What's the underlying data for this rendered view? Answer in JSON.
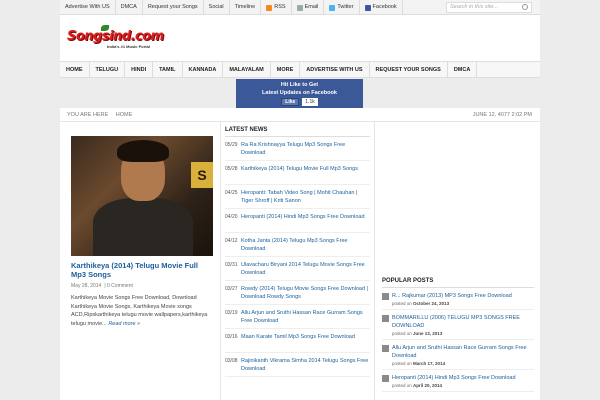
{
  "topbar": {
    "links": [
      "Advertise With US",
      "DMCA",
      "Request your Songs",
      "Social",
      "Timeline"
    ],
    "social": [
      {
        "label": "RSS",
        "icon": "rss-icon"
      },
      {
        "label": "Email",
        "icon": "email-icon"
      },
      {
        "label": "Twitter",
        "icon": "twitter-icon"
      },
      {
        "label": "Facebook",
        "icon": "facebook-icon"
      }
    ],
    "search_placeholder": "Search in this site..."
  },
  "logo": {
    "word": "Songsind.com",
    "tagline": "India's #1 Music Portal"
  },
  "nav": [
    "HOME",
    "TELUGU",
    "HINDI",
    "TAMIL",
    "KANNADA",
    "MALAYALAM",
    "MORE",
    "ADVERTISE WITH US",
    "REQUEST YOUR SONGS",
    "DMCA"
  ],
  "fb_box": {
    "line1": "Hit Like to Get",
    "line2": "Latest Updates on Facebook",
    "like": "Like",
    "count": "1.1k"
  },
  "breadcrumb": {
    "label": "YOU ARE HERE",
    "item": "HOME",
    "date": "JUNE 12, 4077 2:02 PM"
  },
  "featured": {
    "image_label": "S",
    "title": "Karthikeya (2014) Telugu Movie Full Mp3 Songs",
    "date": "May 28, 2014",
    "comments": "0 Comment",
    "excerpt": "Karthikeya Movie Songs Free Download, Download Karthikeya Movie Songs, Karthikeya Movie songs ACD,Ripskarthikeya telugu movie wallpapers,karthikeya telugu movie...",
    "more": "Read more »"
  },
  "latest": {
    "heading": "LATEST NEWS",
    "items": [
      {
        "date": "05/29",
        "title": "Ra Ra Krishnayya Telugu Mp3 Songs Free Download"
      },
      {
        "date": "05/28",
        "title": "Karthikeya (2014) Telugu Movie Full Mp3 Songs"
      },
      {
        "date": "04/25",
        "title": "Heropanti: Tabah Video Song | Mohit Chauhan | Tiger Shroff | Kriti Sanon"
      },
      {
        "date": "04/20",
        "title": "Heropanti (2014) Hindi Mp3 Songs Free Download"
      },
      {
        "date": "04/12",
        "title": "Kotha Janta (2014) Telugu Mp3 Songs Free Download"
      },
      {
        "date": "03/31",
        "title": "Ulavacharu Biryani 2014 Telugu Movie Songs Free Download"
      },
      {
        "date": "03/27",
        "title": "Rowdy (2014) Telugu Movie Songs Free Download | Download Rowdy Songs"
      },
      {
        "date": "03/19",
        "title": "Allu Arjun and Sruthi Hassan Race Gurram Songs Free Download"
      },
      {
        "date": "03/16",
        "title": "Maan Karate Tamil Mp3 Songs Free Download"
      },
      {
        "date": "03/08",
        "title": "Rajinikanth Vikrama Simha 2014 Telugu Songs Free Download"
      }
    ]
  },
  "popular": {
    "heading": "POPULAR POSTS",
    "items": [
      {
        "title": "R... Rajkumar (2013) MP3 Songs Free Download",
        "posted": "posted on",
        "date": "October 24, 2013"
      },
      {
        "title": "BOMMARILLU (2006) TELUGU MP3 SONGS FREE DOWNLOAD",
        "posted": "posted on",
        "date": "June 13, 2013"
      },
      {
        "title": "Allu Arjun and Sruthi Hassan Race Gurram Songs Free Download",
        "posted": "posted on",
        "date": "March 17, 2014"
      },
      {
        "title": "Heropanti (2014) Hindi Mp3 Songs Free Download",
        "posted": "posted on",
        "date": "April 20, 2014"
      }
    ]
  }
}
